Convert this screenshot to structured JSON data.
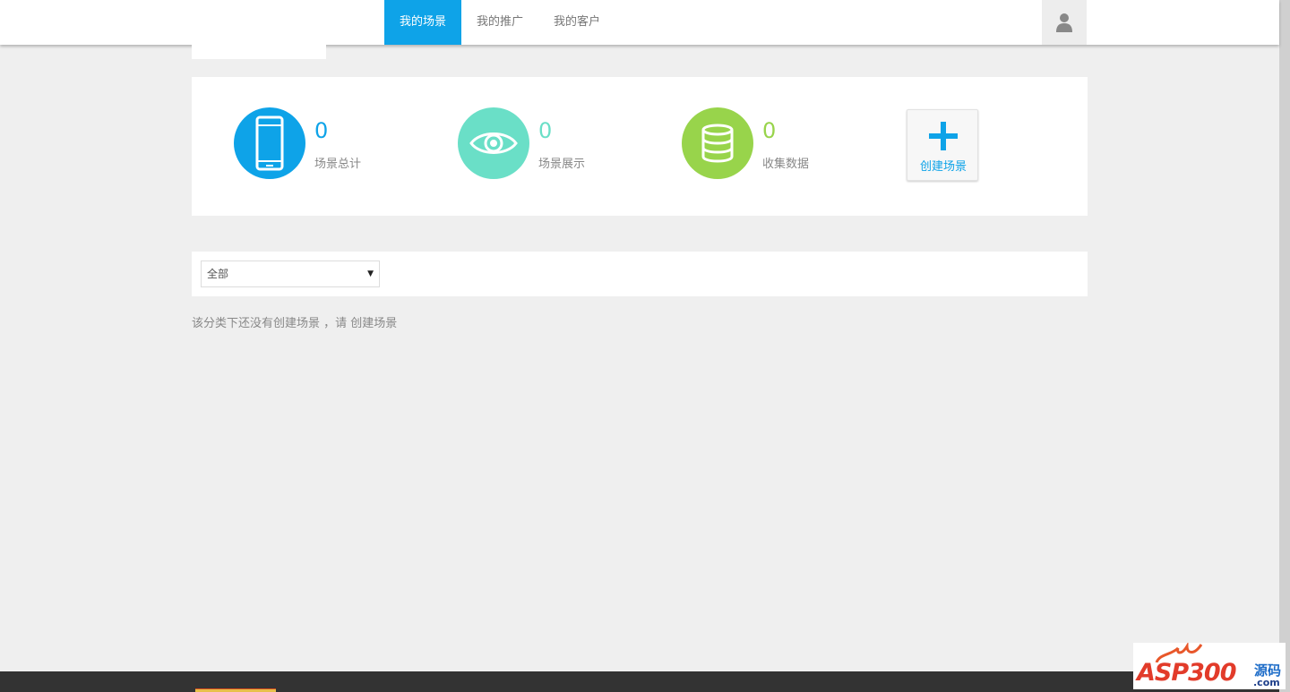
{
  "header": {
    "nav": [
      {
        "label": "我的场景",
        "active": true
      },
      {
        "label": "我的推广",
        "active": false
      },
      {
        "label": "我的客户",
        "active": false
      }
    ],
    "user_icon": "user-icon"
  },
  "stats": [
    {
      "value": "0",
      "label": "场景总计",
      "icon": "phone-icon",
      "color": "#0ea3e8"
    },
    {
      "value": "0",
      "label": "场景展示",
      "icon": "eye-icon",
      "color": "#6adfc7"
    },
    {
      "value": "0",
      "label": "收集数据",
      "icon": "database-icon",
      "color": "#98d44b"
    }
  ],
  "create": {
    "label": "创建场景",
    "icon": "plus-icon"
  },
  "filter": {
    "selected": "全部"
  },
  "empty": {
    "text": "该分类下还没有创建场景 ，请 ",
    "link": "创建场景"
  },
  "watermark": {
    "brand": "ASP300",
    "cn": "源码",
    "domain": ".com"
  },
  "colors": {
    "accent": "#0ea3e8",
    "teal": "#6adfc7",
    "green": "#98d44b",
    "footer": "#333333"
  }
}
